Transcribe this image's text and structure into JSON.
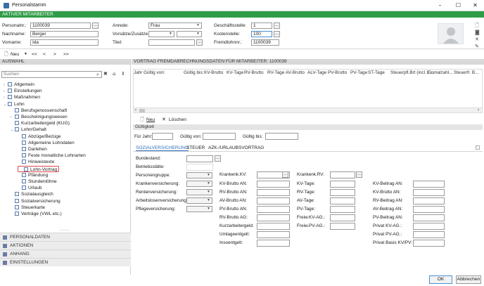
{
  "window": {
    "title": "Personalstamm",
    "min": "–",
    "max": "☐",
    "close": "✕"
  },
  "banner": "AKTIVER MITARBEITER",
  "header": {
    "personalnr_label": "Personalnr.:",
    "personalnr": "1100039",
    "nachname_label": "Nachname:",
    "nachname": "Berger",
    "vorname_label": "Vorname:",
    "vorname": "Ida",
    "anrede_label": "Anrede:",
    "anrede": "Frau",
    "vorsaetze_label": "Vorsätze/Zusätze:",
    "titel_label": "Titel:",
    "geschaeftsstelle_label": "Geschäftsstelle:",
    "geschaeftsstelle": "1",
    "kostenstelle_label": "Kostenstelle:",
    "kostenstelle": "100",
    "fremdlohnnr_label": "Fremdlohnnr.:",
    "fremdlohnnr": "1100039",
    "dots": "..."
  },
  "toolbar": {
    "neu": "Neu",
    "first": "<<",
    "prev": "<",
    "next": ">",
    "last": ">>"
  },
  "left": {
    "title": "AUSWAHL",
    "search_placeholder": "Suchen",
    "tree": [
      {
        "label": "Allgemein",
        "level": 0,
        "exp": "›"
      },
      {
        "label": "Einstellungen",
        "level": 0,
        "exp": "›"
      },
      {
        "label": "Maßnahmen",
        "level": 0,
        "exp": "›"
      },
      {
        "label": "Lohn",
        "level": 0,
        "exp": "⌄"
      },
      {
        "label": "Berufsgenossenschaft",
        "level": 1,
        "exp": ""
      },
      {
        "label": "Bescheinigungswesen",
        "level": 1,
        "exp": "›"
      },
      {
        "label": "Kurzarbeitergeld (KUG)",
        "level": 1,
        "exp": ""
      },
      {
        "label": "Lohn/Gehalt",
        "level": 1,
        "exp": "⌄"
      },
      {
        "label": "Abzüge/Bezüge",
        "level": 2,
        "exp": ""
      },
      {
        "label": "Allgemeine Lohndaten",
        "level": 2,
        "exp": ""
      },
      {
        "label": "Darlehen",
        "level": 2,
        "exp": ""
      },
      {
        "label": "Feste monatliche Lohnarten",
        "level": 2,
        "exp": ""
      },
      {
        "label": "Hinweistexte",
        "level": 2,
        "exp": ""
      },
      {
        "label": "Lohn-Vortrag",
        "level": 2,
        "exp": "",
        "hl": true
      },
      {
        "label": "Pfändung",
        "level": 2,
        "exp": ""
      },
      {
        "label": "Stundenlöhne",
        "level": 2,
        "exp": ""
      },
      {
        "label": "Urlaub",
        "level": 2,
        "exp": ""
      },
      {
        "label": "Sozialausgleich",
        "level": 1,
        "exp": ""
      },
      {
        "label": "Sozialversicherung",
        "level": 1,
        "exp": ""
      },
      {
        "label": "Steuerkarte",
        "level": 1,
        "exp": ""
      },
      {
        "label": "Verträge (VWL etc.)",
        "level": 1,
        "exp": ""
      }
    ],
    "nav": [
      "PERSONALDATEN",
      "AKTIONEN",
      "ANHANG",
      "EINSTELLUNGEN"
    ]
  },
  "right": {
    "title": "VORTRAG FREMDABRECHNUNGSDATEN FÜR MITARBEITER: 1100039",
    "columns": [
      "Jahr",
      "Gültig von:",
      "Gültig bis:",
      "KV-Brutto",
      "KV-Tage",
      "RV-Brutto",
      "RV-Tage",
      "AV-Brutto",
      "ALV-Tage",
      "PV-Brutto",
      "PV-Tage",
      "ST-Tage",
      "Steuerpfl.Brt (incl. E...",
      "Einmalzahl...",
      "Steuerfr. B..."
    ],
    "neu": "Neu",
    "loeschen": "Löschen",
    "gueltigkeit": "Gültigkeit",
    "fuer_jahr": "Für Jahr:",
    "gueltig_von": "Gültig von:",
    "gueltig_bis": "Gültig bis:",
    "tabs": [
      "SOZIALVERSICHERUNG",
      "STEUER",
      "AZK-/URLAUBSVORTRAG"
    ],
    "col1": [
      "Bundesland:",
      "Betriebsstätte:",
      "Personengruppe:",
      "Krankenversicherung:",
      "Rentenversicherung:",
      "Arbeitslosenversicherung:",
      "Pflegeversicherung:"
    ],
    "col2": [
      "Krankenk.KV:",
      "KV-Brutto AN:",
      "RV-Brutto AN:",
      "AV-Brutto AN:",
      "PV-Brutto AN:",
      "RV-Brutto AG:",
      "Kurzarbeitergeld:",
      "Umlageentgelt:",
      "Insoentgelt:"
    ],
    "col3": [
      "Krankenk.RV:",
      "KV-Tage:",
      "RV-Tage:",
      "AV-Tage:",
      "PV-Tage:",
      "Freiw.KV-AG.:",
      "Freiw.PV-AG.:"
    ],
    "col4": [
      "KV-Beitrag AN:",
      "KV-Brutto AN:",
      "RV-Beitrag AN:",
      "AV-Beitrag AN:",
      "PV-Beitrag AN:",
      "Privat KV-AG.:",
      "Privat PV-AG.:",
      "Privat Basis KV/PV:"
    ]
  },
  "footer": {
    "ok": "OK",
    "abbrechen": "Abbrechen"
  }
}
